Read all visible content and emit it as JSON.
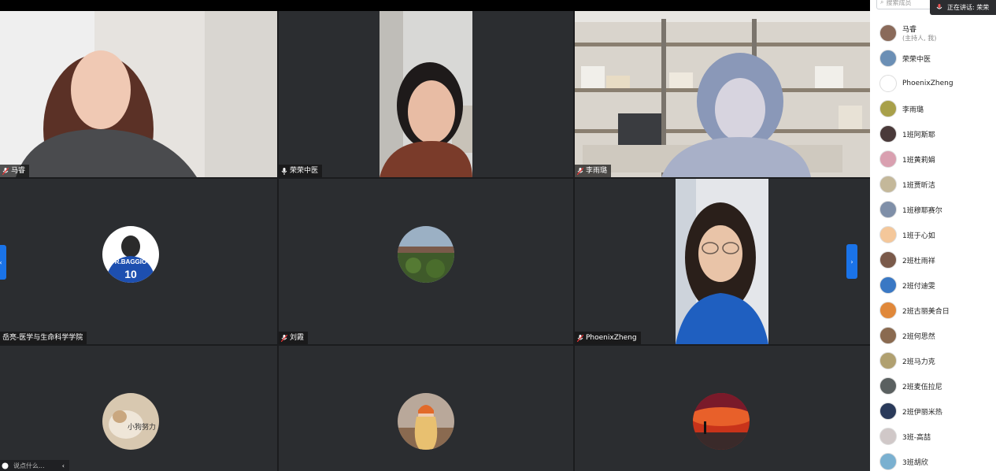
{
  "sidebar": {
    "search_placeholder": "搜索成员",
    "speaking_label": "正在讲话: 荣荣",
    "participants": [
      {
        "name": "马睿",
        "sub": "(主持人, 我)",
        "color": "#8a6a5a"
      },
      {
        "name": "荣荣中医",
        "sub": "",
        "color": "#6b8fb5"
      },
      {
        "name": "PhoenixZheng",
        "sub": "",
        "color": "#ffffff"
      },
      {
        "name": "李雨璐",
        "sub": "",
        "color": "#a8a04a"
      },
      {
        "name": "1班阿斯耶",
        "sub": "",
        "color": "#4a3a3a"
      },
      {
        "name": "1班黄莉娟",
        "sub": "",
        "color": "#d9a0b0"
      },
      {
        "name": "1班贾昕洁",
        "sub": "",
        "color": "#c4b89a"
      },
      {
        "name": "1班穆耶赛尔",
        "sub": "",
        "color": "#7f8fa8"
      },
      {
        "name": "1班于心如",
        "sub": "",
        "color": "#f4c79a"
      },
      {
        "name": "2班杜雨祥",
        "sub": "",
        "color": "#7a5a4a"
      },
      {
        "name": "2班付迪雯",
        "sub": "",
        "color": "#3a78c4"
      },
      {
        "name": "2班古丽美合日",
        "sub": "",
        "color": "#e0883a"
      },
      {
        "name": "2班何思然",
        "sub": "",
        "color": "#8a6a50"
      },
      {
        "name": "2班马力克",
        "sub": "",
        "color": "#b0a070"
      },
      {
        "name": "2班麦伍拉尼",
        "sub": "",
        "color": "#5a6060"
      },
      {
        "name": "2班伊丽米热",
        "sub": "",
        "color": "#2a3a5a"
      },
      {
        "name": "3班-高喆",
        "sub": "",
        "color": "#d0c8c8"
      },
      {
        "name": "3班胡欣",
        "sub": "",
        "color": "#7ab0d0"
      }
    ]
  },
  "tiles": [
    {
      "name": "马睿"
    },
    {
      "name": "荣荣中医"
    },
    {
      "name": "李雨璐"
    },
    {
      "name": "岳亮-医学与生命科学学院"
    },
    {
      "name": "刘霞"
    },
    {
      "name": "PhoenixZheng"
    },
    {
      "name": ""
    },
    {
      "name": ""
    },
    {
      "name": ""
    }
  ],
  "avatars": {
    "baggio_text": "R.BAGGIO",
    "baggio_number": "10",
    "dog_text": "小狗努力"
  },
  "chat": {
    "placeholder": "说点什么..."
  },
  "colors": {
    "active_border": "#2e9f5a",
    "nav_blue": "#1a73e8"
  }
}
